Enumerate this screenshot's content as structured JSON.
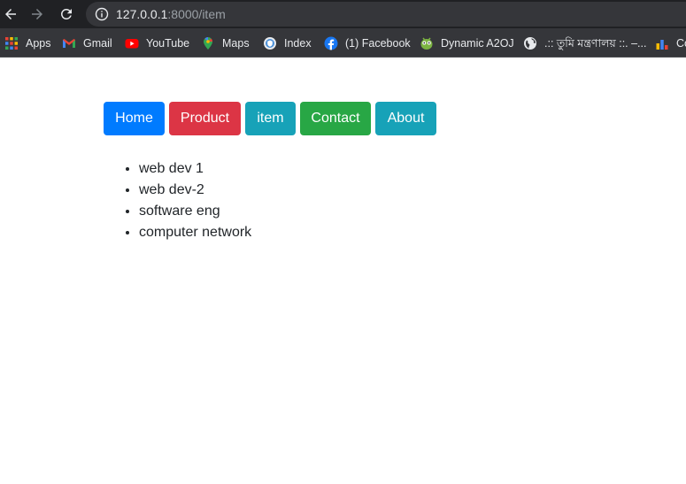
{
  "browser": {
    "url_host": "127.0.0.1",
    "url_rest": ":8000/item",
    "bookmarks": [
      {
        "label": "Apps",
        "icon": "apps-grid-icon"
      },
      {
        "label": "Gmail",
        "icon": "gmail-icon"
      },
      {
        "label": "YouTube",
        "icon": "youtube-icon"
      },
      {
        "label": "Maps",
        "icon": "maps-pin-icon"
      },
      {
        "label": "Index",
        "icon": "index-icon"
      },
      {
        "label": "(1) Facebook",
        "icon": "facebook-icon"
      },
      {
        "label": "Dynamic A2OJ",
        "icon": "a2oj-icon"
      },
      {
        "label": ".:: তুমি মন্ত্রণালয় ::. –...",
        "icon": "globe-icon"
      },
      {
        "label": "Co",
        "icon": "chart-icon"
      }
    ]
  },
  "nav": {
    "buttons": [
      {
        "label": "Home",
        "color": "#007bff"
      },
      {
        "label": "Product",
        "color": "#dc3545"
      },
      {
        "label": "item",
        "color": "#17a2b8"
      },
      {
        "label": "Contact",
        "color": "#28a745"
      },
      {
        "label": "About",
        "color": "#17a2b8"
      }
    ]
  },
  "items": [
    "web dev 1",
    "web dev-2",
    "software eng",
    "computer network"
  ]
}
